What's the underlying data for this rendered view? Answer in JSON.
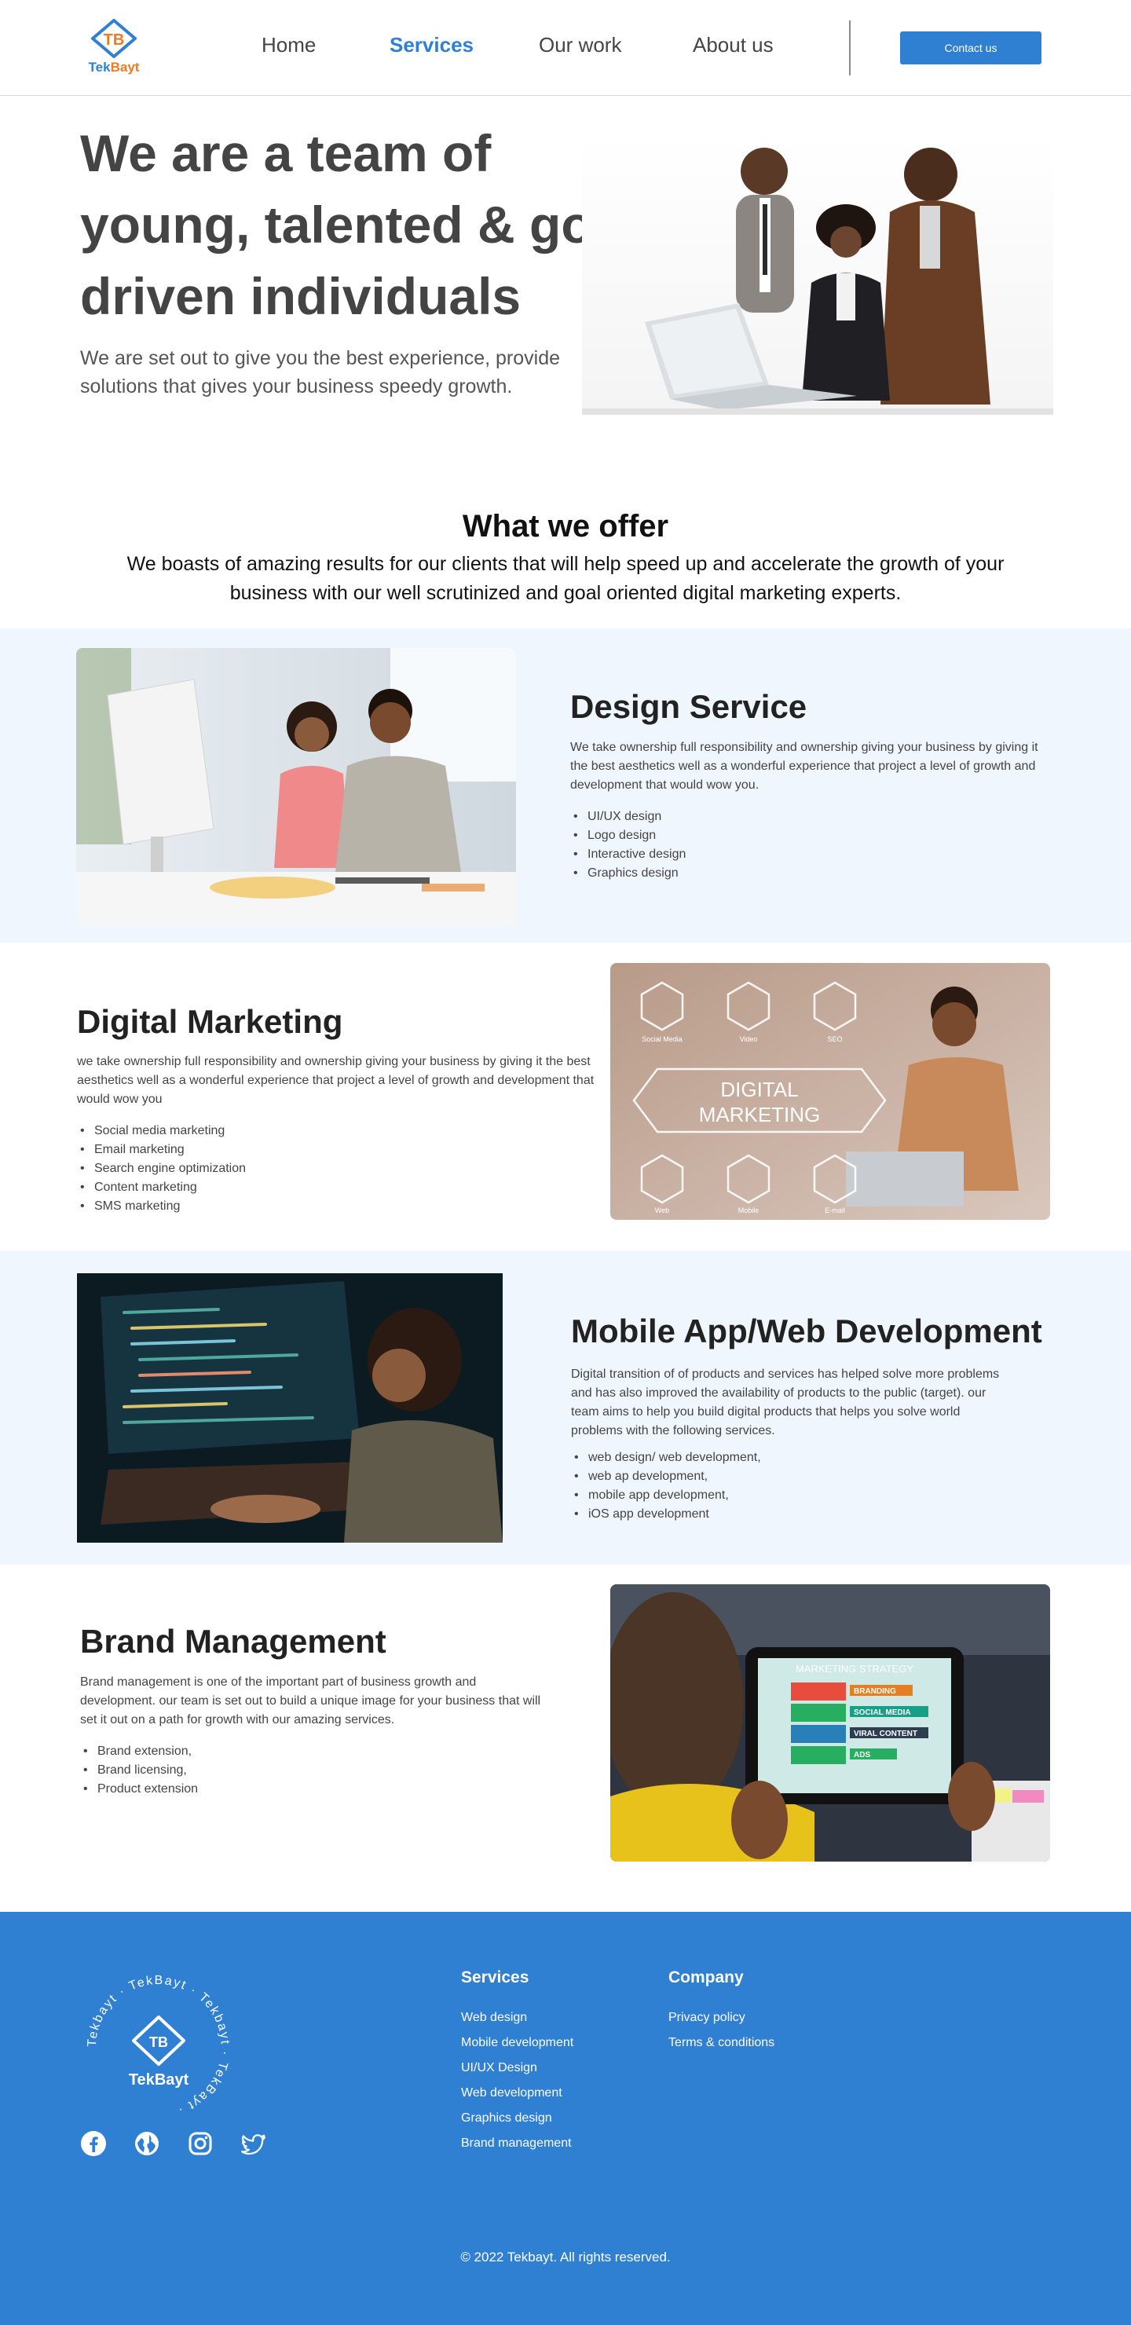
{
  "brand": {
    "name_part1": "Tek",
    "name_part2": "Bayt",
    "monogram": "TB",
    "primary_color": "#2f7fd3",
    "accent_color": "#f07a22"
  },
  "header": {
    "nav": [
      {
        "label": "Home",
        "active": false
      },
      {
        "label": "Services",
        "active": true
      },
      {
        "label": "Our work",
        "active": false
      },
      {
        "label": "About us",
        "active": false
      }
    ],
    "contact_label": "Contact us"
  },
  "hero": {
    "title": "We are a team of young, talented & goal driven individuals",
    "subtitle": "We are set out to give you the best experience, provide solutions that gives your business speedy growth."
  },
  "offer": {
    "title": "What we offer",
    "subtitle": "We boasts of amazing results for our clients that will help speed up and accelerate the growth of your business with our well scrutinized and goal oriented digital marketing  experts."
  },
  "services": [
    {
      "title": "Design Service",
      "description": "We take ownership full responsibility and ownership giving your business by giving it  the best aesthetics well as a wonderful experience that project a level of growth and development that would wow you.",
      "items": [
        "UI/UX design",
        "Logo design",
        "Interactive design",
        "Graphics design"
      ]
    },
    {
      "title": "Digital Marketing",
      "description": "we take ownership full responsibility and ownership giving your business by giving it the best aesthetics well as a wonderful experience that project a level of growth and development that would wow you",
      "items": [
        "Social media marketing",
        "Email marketing",
        "Search engine optimization",
        "Content marketing",
        "SMS marketing"
      ],
      "image_labels": {
        "center_line1": "DIGITAL",
        "center_line2": "MARKETING",
        "tile1": "Social Media",
        "tile2": "Video",
        "tile3": "SEO",
        "tile4": "Web",
        "tile5": "Mobile",
        "tile6": "E-mail"
      }
    },
    {
      "title": "Mobile App/Web Development",
      "description": "Digital transition of of products and services has helped solve more problems and has also improved the availability of products to the public (target). our team aims to help you build digital products that helps you solve world problems with the following services.",
      "items": [
        "web design/ web development,",
        "web ap development,",
        "mobile app development,",
        "iOS app development"
      ]
    },
    {
      "title": "Brand Management",
      "description": "Brand management is one of the important part of business growth and development. our team is set out to build a unique image for your business that will set it out on a path for growth with our amazing services.",
      "items": [
        "Brand extension,",
        "Brand licensing,",
        "Product extension"
      ],
      "image_labels": {
        "screen_title": "MARKETING STRATEGY",
        "row1": "BRANDING",
        "row2": "SOCIAL MEDIA",
        "row3": "VIRAL CONTENT",
        "row4": "ADS"
      }
    }
  ],
  "footer": {
    "badge_ring_text": "Tekbayt · TekBayt · Tekbayt · TekBayt · ",
    "socials": [
      "facebook-icon",
      "globe-icon",
      "instagram-icon",
      "twitter-icon"
    ],
    "services_title": "Services",
    "services_links": [
      "Web design",
      "Mobile development",
      "UI/UX Design",
      "Web development",
      "Graphics design",
      "Brand management"
    ],
    "company_title": "Company",
    "company_links": [
      "Privacy policy",
      "Terms & conditions"
    ],
    "copyright": "© 2022 Tekbayt. All rights reserved."
  }
}
